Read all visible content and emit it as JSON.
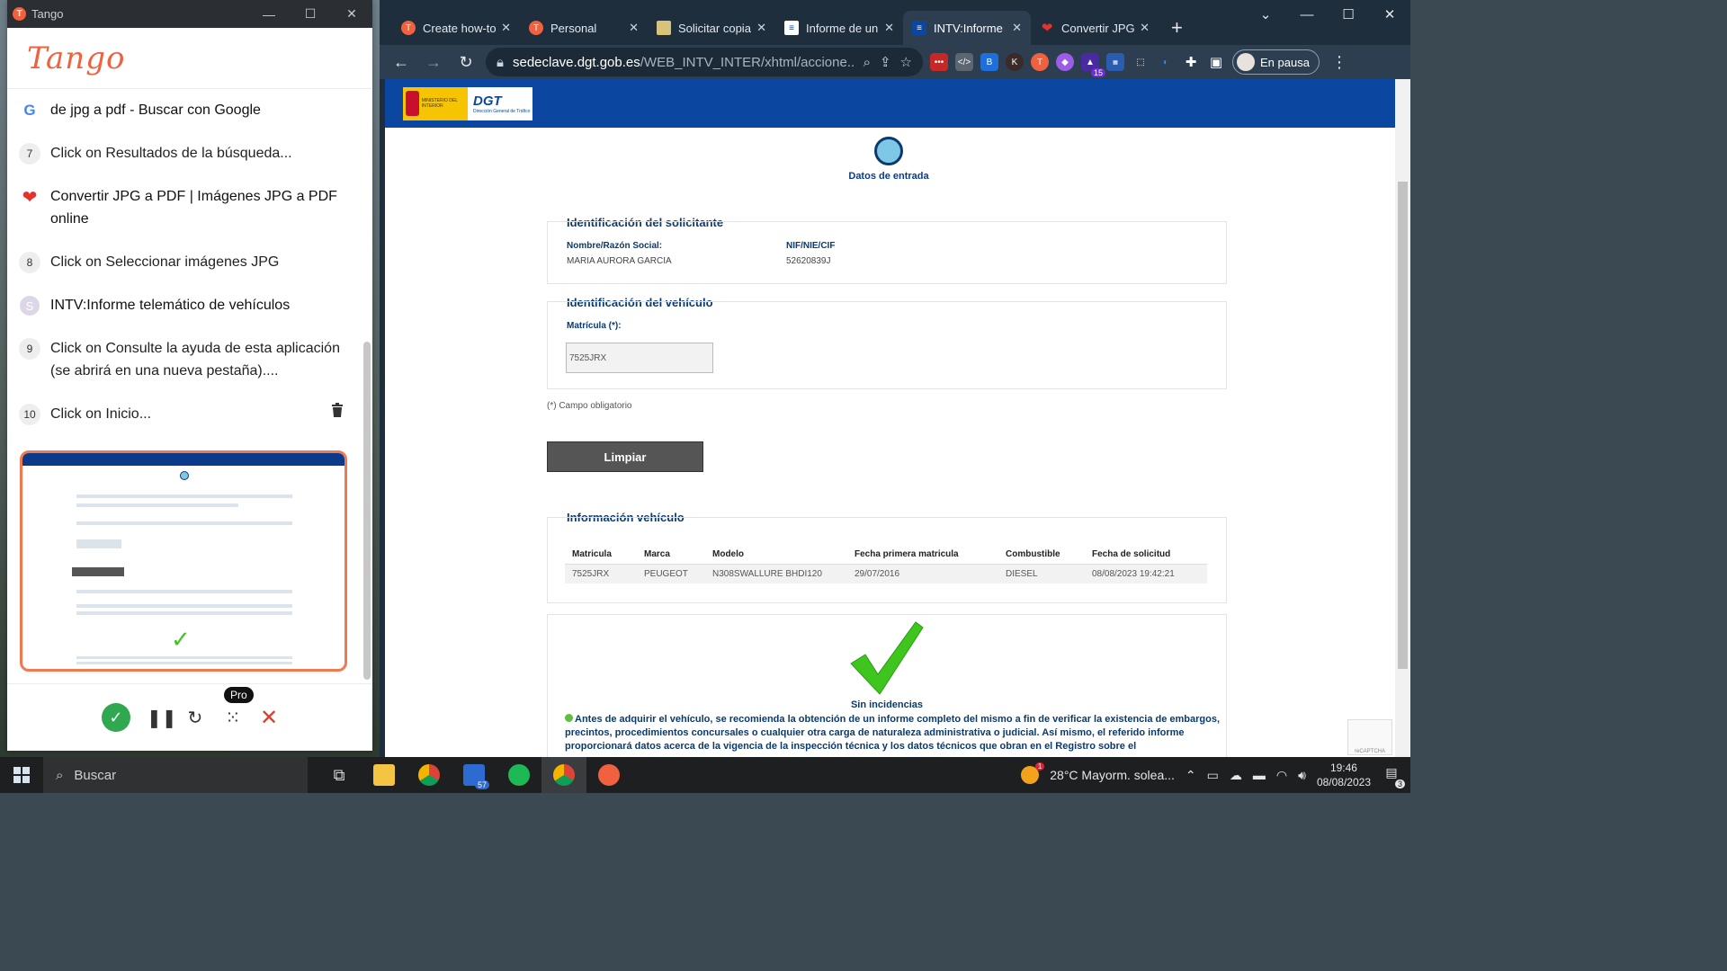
{
  "tango": {
    "window_title": "Tango",
    "logo_text": "Tango",
    "steps": [
      {
        "kind": "page",
        "icon": "google-icon",
        "text": "de jpg a pdf - Buscar con Google"
      },
      {
        "kind": "step",
        "number": "7",
        "text": "Click on Resultados de la búsqueda..."
      },
      {
        "kind": "page",
        "icon": "heart-icon",
        "text": "Convertir JPG a PDF | Imágenes JPG a PDF online"
      },
      {
        "kind": "step",
        "number": "8",
        "text": "Click on Seleccionar imágenes JPG"
      },
      {
        "kind": "page",
        "icon": "s-avatar-icon",
        "avatar_letter": "S",
        "text": "INTV:Informe telemático de vehículos"
      },
      {
        "kind": "step",
        "number": "9",
        "text": "Click on Consulte la ayuda de esta aplicación (se abrirá en una nueva pestaña)...."
      },
      {
        "kind": "step",
        "number": "10",
        "text": "Click on Inicio..."
      }
    ],
    "pro_label": "Pro"
  },
  "browser": {
    "tabs": [
      {
        "label": "Create how-to",
        "favicon": "tango-icon",
        "color": "#f0613f",
        "active": false
      },
      {
        "label": "Personal",
        "favicon": "tango-icon",
        "color": "#f0613f",
        "active": false
      },
      {
        "label": "Solicitar copia",
        "favicon": "document-icon",
        "color": "#d9c27a",
        "active": false
      },
      {
        "label": "Informe de un",
        "favicon": "dgt-icon",
        "color": "#0b47a1",
        "active": false
      },
      {
        "label": "INTV:Informe",
        "favicon": "dgt-icon",
        "color": "#0b47a1",
        "active": true
      },
      {
        "label": "Convertir JPG",
        "favicon": "heart-icon",
        "color": "#e5322d",
        "active": false
      }
    ],
    "url_domain": "sedeclave.dgt.gob.es",
    "url_path": "/WEB_INTV_INTER/xhtml/accione...",
    "profile_label": "En pausa",
    "extension_badge": "15"
  },
  "page": {
    "logo_ministry": "MINISTERIO DEL INTERIOR",
    "logo_dgt": "DGT",
    "logo_dgt_sub": "Dirección General de Tráfico",
    "step_label": "Datos de entrada",
    "applicant": {
      "title": "Identificación del solicitante",
      "name_label": "Nombre/Razón Social:",
      "name_value": "MARIA AURORA GARCIA",
      "nif_label": "NIF/NIE/CIF",
      "nif_value": "52620839J"
    },
    "vehicle": {
      "title": "Identificación del vehículo",
      "plate_label": "Matrícula (*):",
      "plate_value": "7525JRX"
    },
    "mandatory_note": "(*) Campo obligatorio",
    "clear_button": "Limpiar",
    "info": {
      "title": "Información vehículo",
      "headers": [
        "Matricula",
        "Marca",
        "Modelo",
        "Fecha primera matricula",
        "Combustible",
        "Fecha de solicitud"
      ],
      "row": [
        "7525JRX",
        "PEUGEOT",
        "N308SWALLURE BHDI120",
        "29/07/2016",
        "DIESEL",
        "08/08/2023 19:42:21"
      ]
    },
    "result_label": "Sin incidencias",
    "notice_text": "Antes de adquirir el vehículo, se recomienda la obtención de un informe completo del mismo a fin de verificar la existencia de embargos, precintos, procedimientos concursales o cualquier otra carga de naturaleza administrativa o judicial. Así mismo, el referido informe proporcionará datos acerca de la vigencia de la inspección técnica y los datos técnicos que obran en el Registro sobre el"
  },
  "taskbar": {
    "search_placeholder": "Buscar",
    "mail_badge": "57",
    "weather": "28°C  Mayorm. solea...",
    "weather_badge": "1",
    "time": "19:46",
    "date": "08/08/2023",
    "notification_count": "3"
  }
}
